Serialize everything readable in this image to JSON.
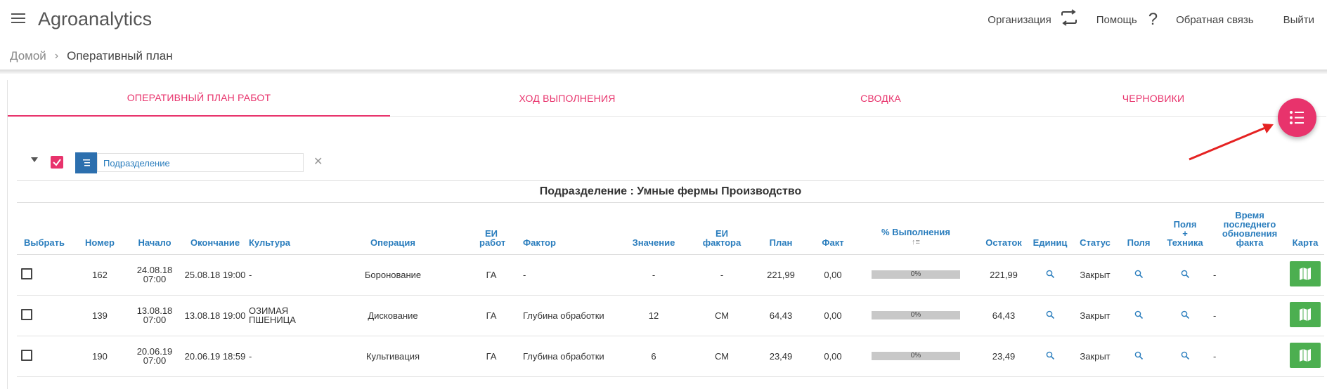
{
  "header": {
    "app_title": "Agroanalytics",
    "org_label": "Организация",
    "help_label": "Помощь",
    "feedback_label": "Обратная связь",
    "logout_label": "Выйти"
  },
  "breadcrumb": {
    "home": "Домой",
    "current": "Оперативный план"
  },
  "tabs": [
    {
      "label": "ОПЕРАТИВНЫЙ ПЛАН РАБОТ",
      "active": true
    },
    {
      "label": "ХОД ВЫПОЛНЕНИЯ"
    },
    {
      "label": "СВОДКА"
    },
    {
      "label": "ЧЕРНОВИКИ"
    }
  ],
  "filter": {
    "group_by": "Подразделение"
  },
  "group_title": "Подразделение : Умные фермы Производство",
  "columns": {
    "select": "Выбрать",
    "number": "Номер",
    "start": "Начало",
    "end": "Окончание",
    "crop": "Культура",
    "operation": "Операция",
    "unit_work": "ЕИ работ",
    "factor": "Фактор",
    "value": "Значение",
    "unit_factor": "ЕИ фактора",
    "plan": "План",
    "fact": "Факт",
    "percent": "% Выполнения",
    "rest": "Остаток",
    "units": "Единиц",
    "status": "Статус",
    "fields": "Поля",
    "fields_tech_1": "Поля",
    "fields_tech_2": "+",
    "fields_tech_3": "Техника",
    "updated_1": "Время",
    "updated_2": "последнего",
    "updated_3": "обновления",
    "updated_4": "факта",
    "map": "Карта"
  },
  "rows": [
    {
      "number": "162",
      "start_date": "24.08.18",
      "start_time": "07:00",
      "end": "25.08.18 19:00",
      "crop_1": "-",
      "crop_2": "",
      "operation": "Боронование",
      "unit_work": "ГА",
      "factor": "-",
      "value": "-",
      "unit_factor": "-",
      "plan": "221,99",
      "fact": "0,00",
      "percent": "0%",
      "rest": "221,99",
      "status": "Закрыт",
      "updated": "-"
    },
    {
      "number": "139",
      "start_date": "13.08.18",
      "start_time": "07:00",
      "end": "13.08.18 19:00",
      "crop_1": "ОЗИМАЯ",
      "crop_2": "ПШЕНИЦА",
      "operation": "Дискование",
      "unit_work": "ГА",
      "factor": "Глубина обработки",
      "value": "12",
      "unit_factor": "СМ",
      "plan": "64,43",
      "fact": "0,00",
      "percent": "0%",
      "rest": "64,43",
      "status": "Закрыт",
      "updated": "-"
    },
    {
      "number": "190",
      "start_date": "20.06.19",
      "start_time": "07:00",
      "end": "20.06.19 18:59",
      "crop_1": "-",
      "crop_2": "",
      "operation": "Культивация",
      "unit_work": "ГА",
      "factor": "Глубина обработки",
      "value": "6",
      "unit_factor": "СМ",
      "plan": "23,49",
      "fact": "0,00",
      "percent": "0%",
      "rest": "23,49",
      "status": "Закрыт",
      "updated": "-"
    }
  ],
  "colors": {
    "accent": "#e8336c",
    "link": "#2a7dbd",
    "map_button": "#4caf50",
    "group_button": "#2c6fae"
  }
}
